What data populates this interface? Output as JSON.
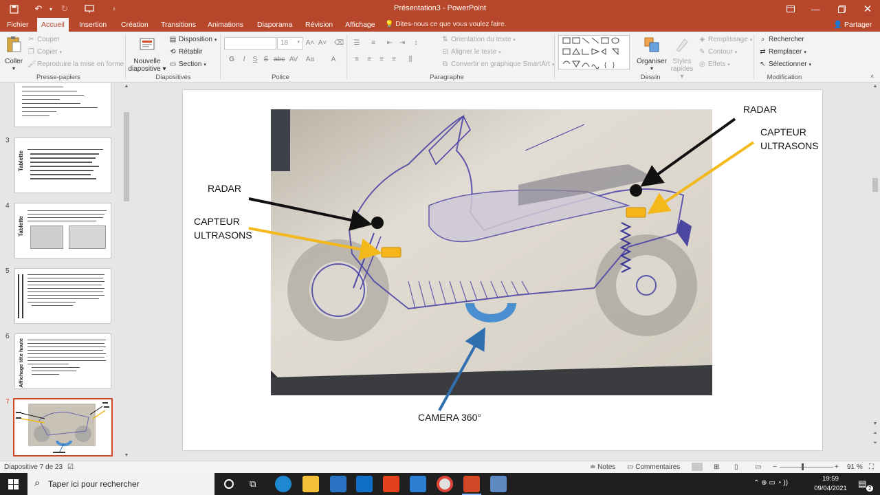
{
  "window": {
    "title": "Présentation3 - PowerPoint"
  },
  "ribbon_tabs": [
    {
      "label": "Fichier"
    },
    {
      "label": "Accueil"
    },
    {
      "label": "Insertion"
    },
    {
      "label": "Création"
    },
    {
      "label": "Transitions"
    },
    {
      "label": "Animations"
    },
    {
      "label": "Diaporama"
    },
    {
      "label": "Révision"
    },
    {
      "label": "Affichage"
    }
  ],
  "tell_me": "Dites-nous ce que vous voulez faire.",
  "share_label": "Partager",
  "ribbon": {
    "clipboard": {
      "paste": "Coller",
      "cut": "Couper",
      "copy": "Copier",
      "format_painter": "Reproduire la mise en forme",
      "group": "Presse-papiers"
    },
    "slides": {
      "new_slide_1": "Nouvelle",
      "new_slide_2": "diapositive",
      "layout": "Disposition",
      "reset": "Rétablir",
      "section": "Section",
      "group": "Diapositives"
    },
    "font": {
      "size": "18",
      "group": "Police"
    },
    "paragraph": {
      "text_direction": "Orientation du texte",
      "align_text": "Aligner le texte",
      "smartart": "Convertir en graphique SmartArt",
      "group": "Paragraphe"
    },
    "drawing": {
      "arrange": "Organiser",
      "quick_styles_1": "Styles",
      "quick_styles_2": "rapides",
      "fill": "Remplissage",
      "outline": "Contour",
      "effects": "Effets",
      "group": "Dessin"
    },
    "editing": {
      "find": "Rechercher",
      "replace": "Remplacer",
      "select": "Sélectionner",
      "group": "Modification"
    }
  },
  "thumbnails": [
    {
      "number": "3",
      "title": "Tablette"
    },
    {
      "number": "4",
      "title": "Tablette"
    },
    {
      "number": "5",
      "title": ""
    },
    {
      "number": "6",
      "title": "Affichage tête haute"
    },
    {
      "number": "7",
      "title": ""
    }
  ],
  "slide": {
    "radar_left": "RADAR",
    "ultrasonic_left_1": "CAPTEUR",
    "ultrasonic_left_2": "ULTRASONS",
    "radar_right": "RADAR",
    "ultrasonic_right_1": "CAPTEUR",
    "ultrasonic_right_2": "ULTRASONS",
    "camera": "CAMERA 360°"
  },
  "status": {
    "slide_of": "Diapositive 7 de 23",
    "notes": "Notes",
    "comments": "Commentaires",
    "zoom": "91 %"
  },
  "taskbar": {
    "search_placeholder": "Taper ici pour rechercher",
    "time": "19:59",
    "date": "09/04/2021",
    "notif_count": "2"
  },
  "colors": {
    "brand": "#b7472a",
    "active_thumb": "#d24726",
    "arrow_black": "#111111",
    "arrow_yellow": "#f2b81c",
    "camera_blue": "#4a8fd0"
  },
  "icons": [
    "save-icon",
    "undo-icon",
    "redo-icon",
    "present-icon",
    "customize-icon",
    "search-icon",
    "windows-icon",
    "edge-icon",
    "explorer-icon",
    "store-icon",
    "mail-icon",
    "office-icon",
    "powerpoint-icon",
    "chrome-icon"
  ]
}
